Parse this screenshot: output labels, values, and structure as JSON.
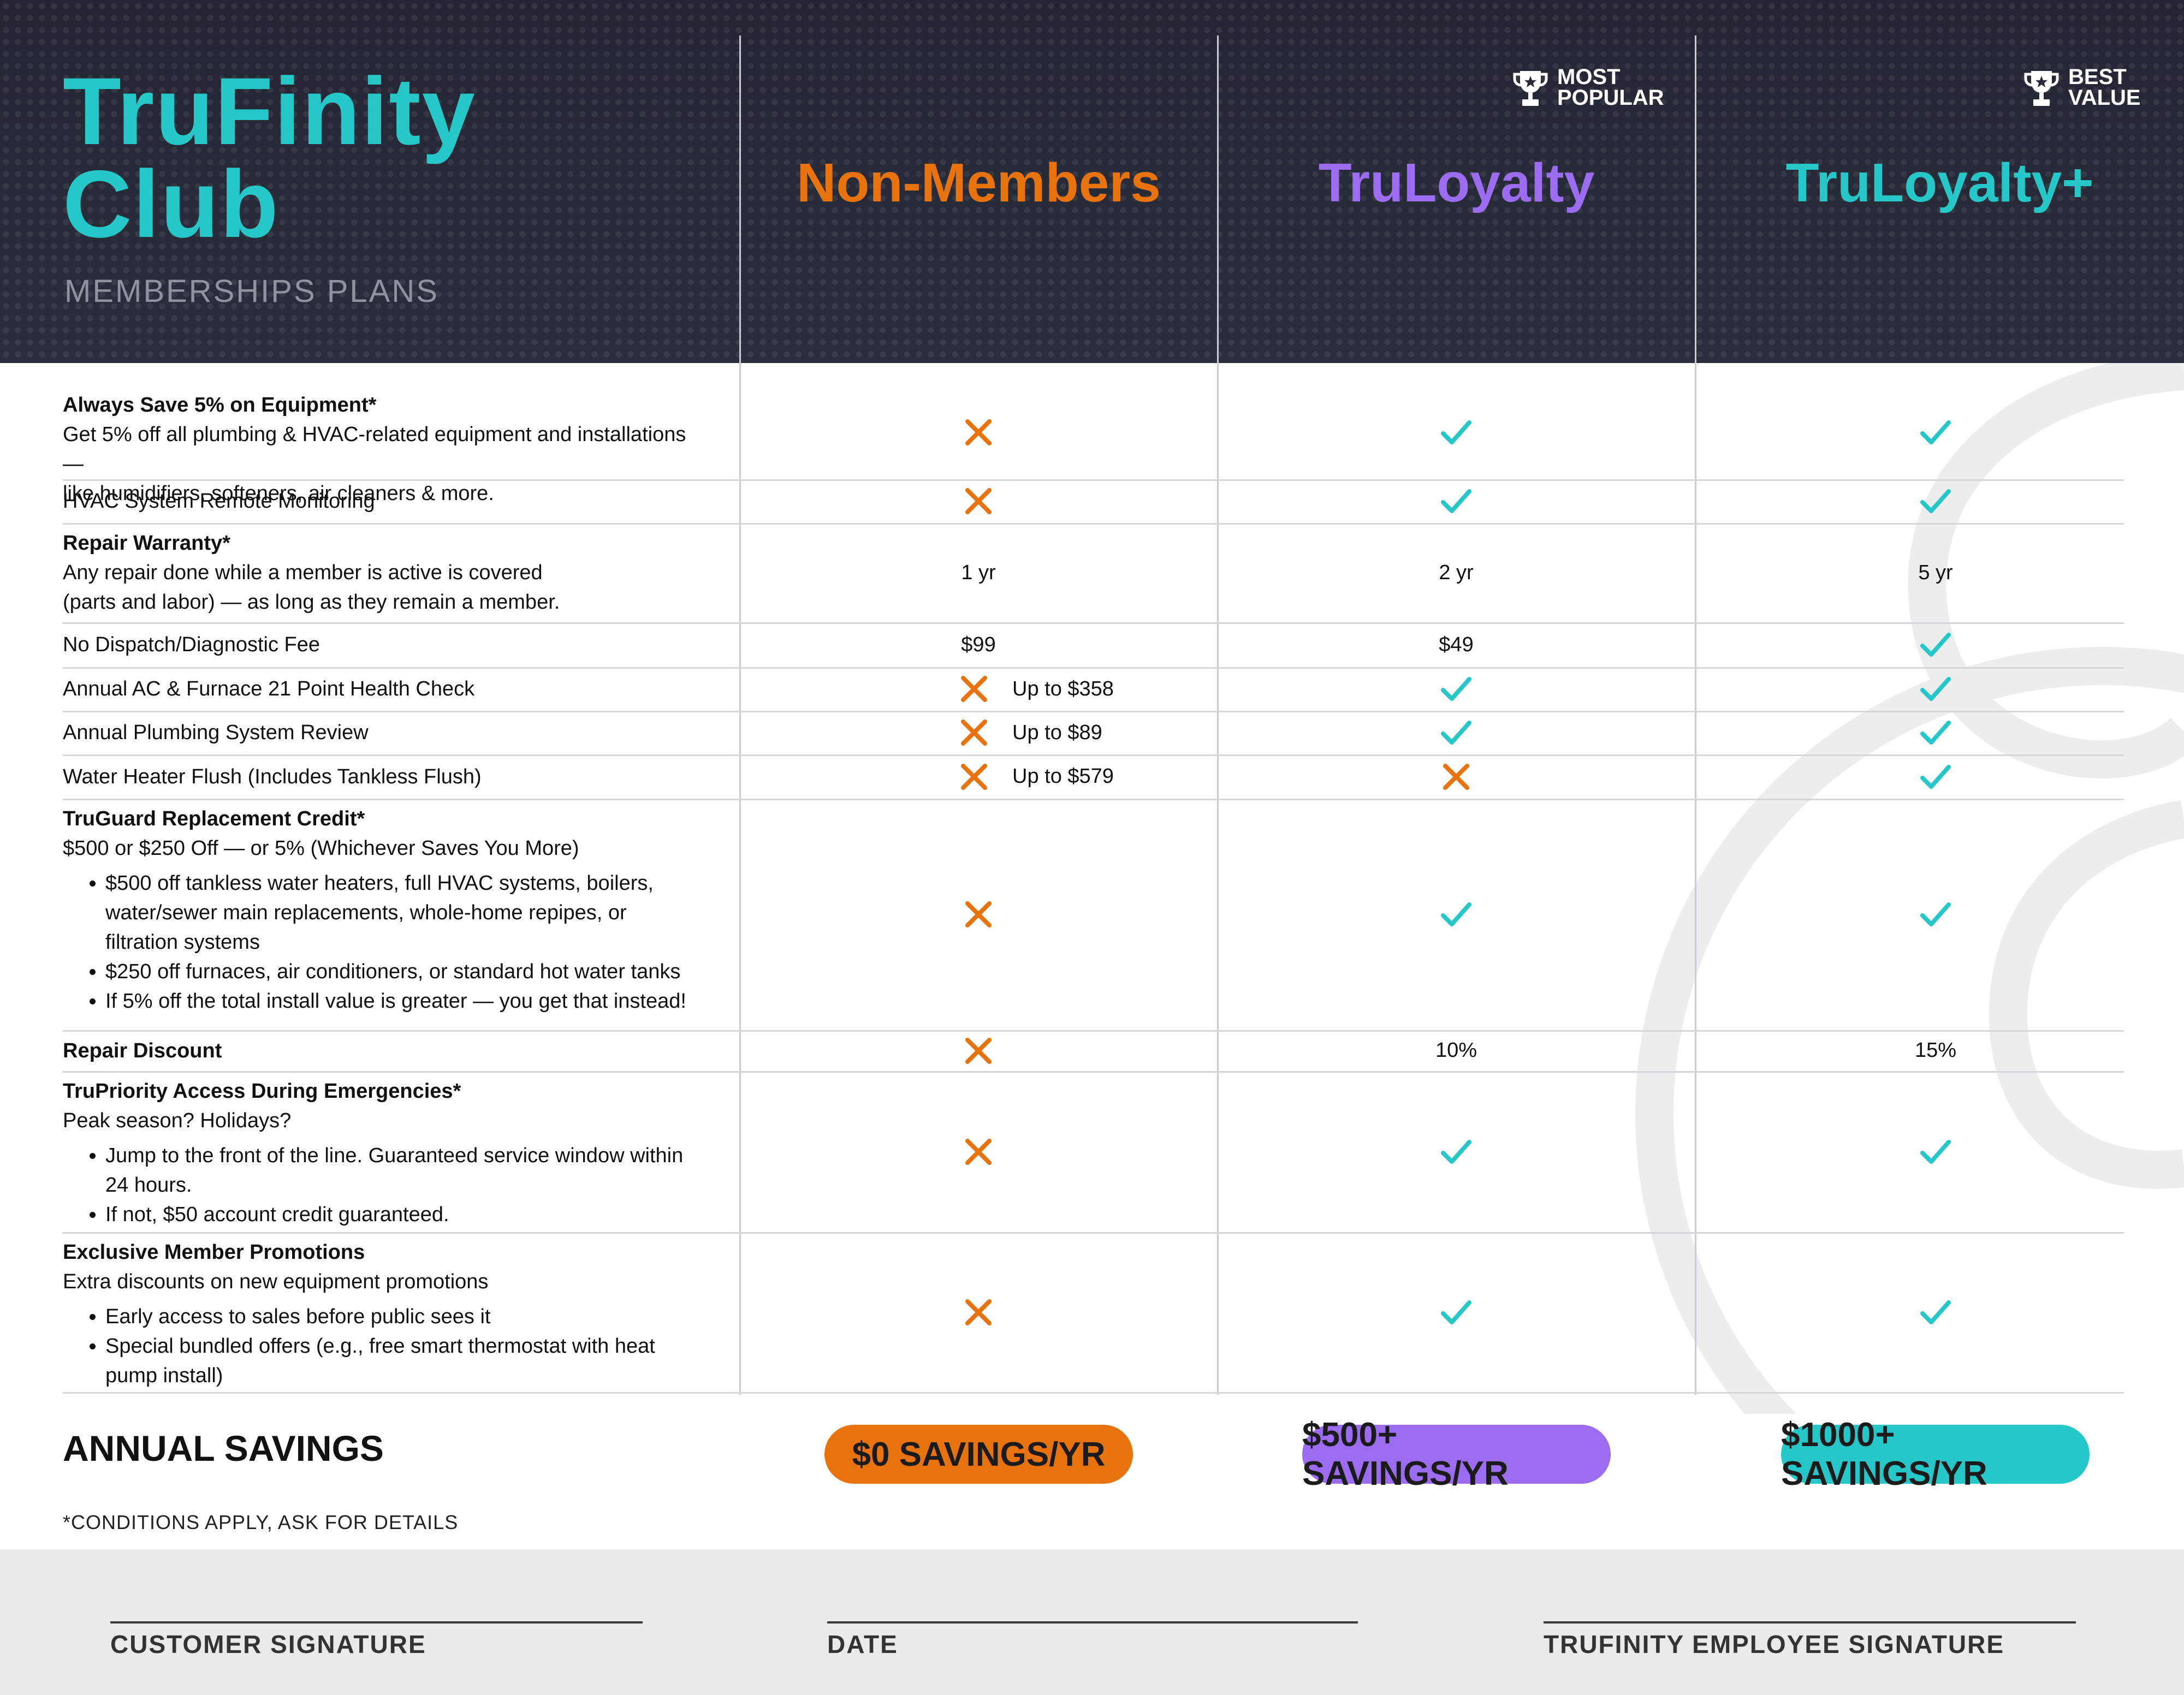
{
  "header": {
    "brand_line1": "TruFinity",
    "brand_line2": "Club",
    "subtitle": "MEMBERSHIPS PLANS"
  },
  "plans": [
    {
      "name": "Non-Members",
      "color": "#e8730c",
      "badge": ""
    },
    {
      "name": "TruLoyalty",
      "color": "#9b6cf0",
      "badge_line1": "MOST",
      "badge_line2": "POPULAR"
    },
    {
      "name": "TruLoyalty+",
      "color": "#26c7c9",
      "badge_line1": "BEST",
      "badge_line2": "VALUE"
    }
  ],
  "rows": [
    {
      "title": "Always Save 5% on Equipment*",
      "desc": [
        "Get 5% off all plumbing & HVAC-related equipment and installations —",
        "like humidifiers, softeners, air cleaners & more."
      ],
      "bullets": [],
      "cells": [
        {
          "type": "x"
        },
        {
          "type": "check"
        },
        {
          "type": "check"
        }
      ]
    },
    {
      "title": "",
      "desc": [
        "HVAC System Remote Monitoring"
      ],
      "bullets": [],
      "cells": [
        {
          "type": "x"
        },
        {
          "type": "check"
        },
        {
          "type": "check"
        }
      ]
    },
    {
      "title": "Repair Warranty*",
      "desc": [
        "Any repair done while a member is active is covered",
        "(parts and labor) — as long as they remain a member."
      ],
      "bullets": [],
      "cells": [
        {
          "type": "text",
          "text": "1 yr"
        },
        {
          "type": "text",
          "text": "2 yr"
        },
        {
          "type": "text",
          "text": "5 yr"
        }
      ]
    },
    {
      "title": "",
      "desc": [
        "No Dispatch/Diagnostic Fee"
      ],
      "bullets": [],
      "cells": [
        {
          "type": "text",
          "text": "$99"
        },
        {
          "type": "text",
          "text": "$49"
        },
        {
          "type": "check"
        }
      ]
    },
    {
      "title": "",
      "desc": [
        "Annual AC & Furnace 21 Point Health Check"
      ],
      "bullets": [],
      "cells": [
        {
          "type": "x",
          "note": "Up to $358"
        },
        {
          "type": "check"
        },
        {
          "type": "check"
        }
      ]
    },
    {
      "title": "",
      "desc": [
        "Annual Plumbing System Review"
      ],
      "bullets": [],
      "cells": [
        {
          "type": "x",
          "note": "Up to $89"
        },
        {
          "type": "check"
        },
        {
          "type": "check"
        }
      ]
    },
    {
      "title": "",
      "desc": [
        "Water Heater Flush (Includes Tankless Flush)"
      ],
      "bullets": [],
      "cells": [
        {
          "type": "x",
          "note": "Up to $579"
        },
        {
          "type": "x"
        },
        {
          "type": "check"
        }
      ]
    },
    {
      "title": "TruGuard Replacement Credit*",
      "desc": [
        "$500 or $250 Off — or 5% (Whichever Saves You More)"
      ],
      "bullets": [
        "$500 off tankless water heaters, full HVAC systems, boilers, water/sewer main replacements, whole-home repipes, or filtration systems",
        "$250 off furnaces, air conditioners, or standard hot water tanks",
        "If 5% off the total install value is greater — you get that instead!"
      ],
      "cells": [
        {
          "type": "x"
        },
        {
          "type": "check"
        },
        {
          "type": "check"
        }
      ]
    },
    {
      "title": "Repair Discount",
      "desc": [],
      "bullets": [],
      "cells": [
        {
          "type": "x"
        },
        {
          "type": "text",
          "text": "10%"
        },
        {
          "type": "text",
          "text": "15%"
        }
      ]
    },
    {
      "title": "TruPriority Access During Emergencies*",
      "desc": [
        "Peak season? Holidays?"
      ],
      "bullets": [
        "Jump to the front of the line. Guaranteed service window within 24 hours.",
        "If not, $50 account credit guaranteed."
      ],
      "cells": [
        {
          "type": "x"
        },
        {
          "type": "check"
        },
        {
          "type": "check"
        }
      ]
    },
    {
      "title": "Exclusive Member Promotions",
      "desc": [
        "Extra discounts on new equipment promotions"
      ],
      "bullets": [
        "Early access to sales before public sees it",
        "Special bundled offers (e.g., free smart thermostat with heat pump install)"
      ],
      "cells": [
        {
          "type": "x"
        },
        {
          "type": "check"
        },
        {
          "type": "check"
        }
      ]
    }
  ],
  "savings": {
    "label": "ANNUAL SAVINGS",
    "values": [
      "$0 SAVINGS/YR",
      "$500+ SAVINGS/YR",
      "$1000+ SAVINGS/YR"
    ]
  },
  "note": "*CONDITIONS APPLY, ASK FOR DETAILS",
  "signatures": [
    "CUSTOMER SIGNATURE",
    "DATE",
    "TRUFINITY EMPLOYEE SIGNATURE"
  ],
  "colors": {
    "orange": "#e8730c",
    "purple": "#9b6cf0",
    "teal": "#26c7c9",
    "header_bg": "#262a36"
  }
}
